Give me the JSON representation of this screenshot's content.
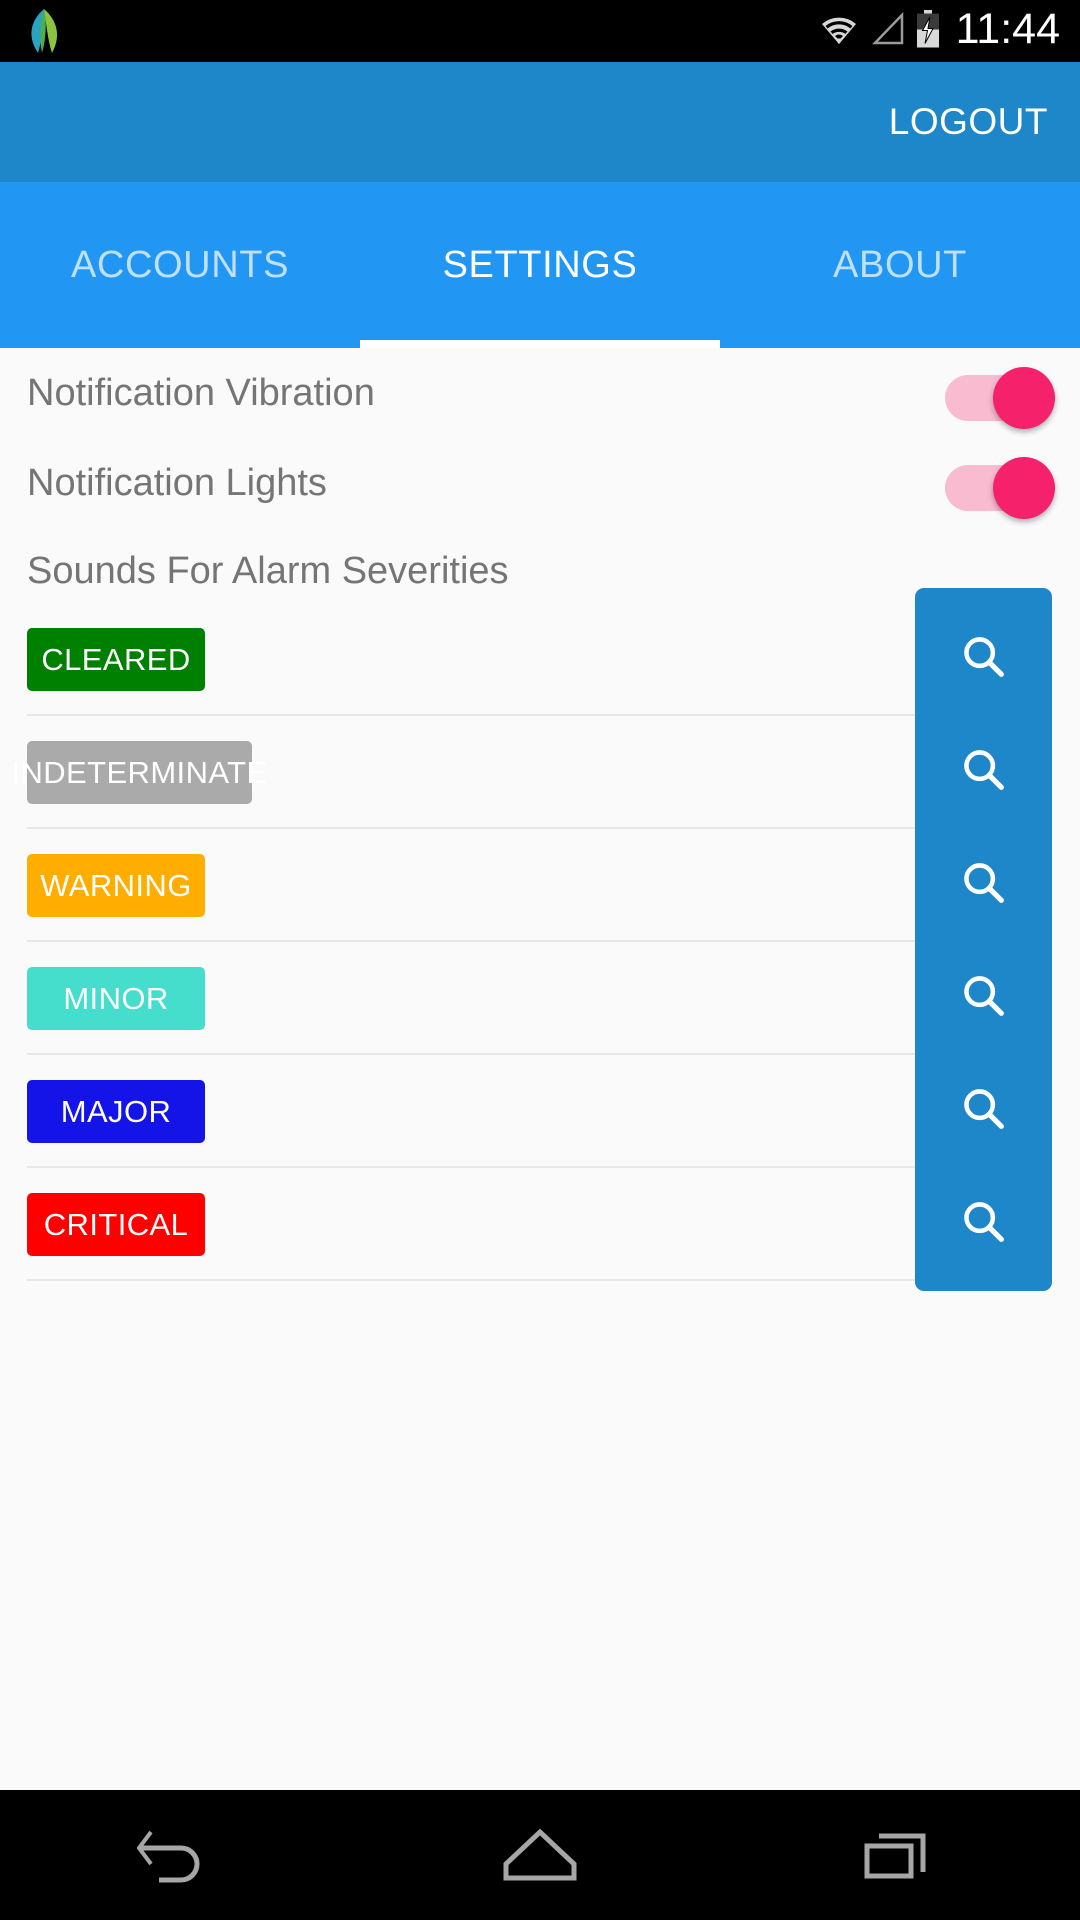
{
  "status_bar": {
    "app_icon": "leaf-icon",
    "wifi_icon": "wifi-icon",
    "signal_icon": "cell-signal-icon",
    "battery_icon": "battery-charging-icon",
    "clock": "11:44"
  },
  "action_bar": {
    "logout_label": "LOGOUT",
    "background": "#1e87c9"
  },
  "tabs": [
    {
      "label": "ACCOUNTS",
      "active": false
    },
    {
      "label": "SETTINGS",
      "active": true
    },
    {
      "label": "ABOUT",
      "active": false
    }
  ],
  "tab_bar": {
    "background": "#2196f3",
    "indicator_color": "#ffffff"
  },
  "settings": {
    "switches": [
      {
        "label": "Notification Vibration",
        "state": "on",
        "icon": "toggle-on-icon"
      },
      {
        "label": "Notification Lights",
        "state": "on",
        "icon": "toggle-on-icon"
      }
    ],
    "switch_track_color": "#f8bbd0",
    "switch_thumb_color": "#f5216b",
    "section_title": "Sounds For Alarm Severities",
    "severities": [
      {
        "label": "CLEARED",
        "color": "#008000",
        "width": "normal",
        "search_icon": "search-icon"
      },
      {
        "label": "INDETERMINATE",
        "color": "#aaaaaa",
        "width": "wide",
        "search_icon": "search-icon"
      },
      {
        "label": "WARNING",
        "color": "#ffad00",
        "width": "normal",
        "search_icon": "search-icon"
      },
      {
        "label": "MINOR",
        "color": "#45ddcb",
        "width": "normal",
        "search_icon": "search-icon"
      },
      {
        "label": "MAJOR",
        "color": "#1414e8",
        "width": "normal",
        "search_icon": "search-icon"
      },
      {
        "label": "CRITICAL",
        "color": "#ff0000",
        "width": "normal",
        "search_icon": "search-icon"
      }
    ],
    "search_button_color": "#1e87c9"
  },
  "nav_bar": {
    "back": "back-icon",
    "home": "home-icon",
    "recents": "recents-icon"
  }
}
